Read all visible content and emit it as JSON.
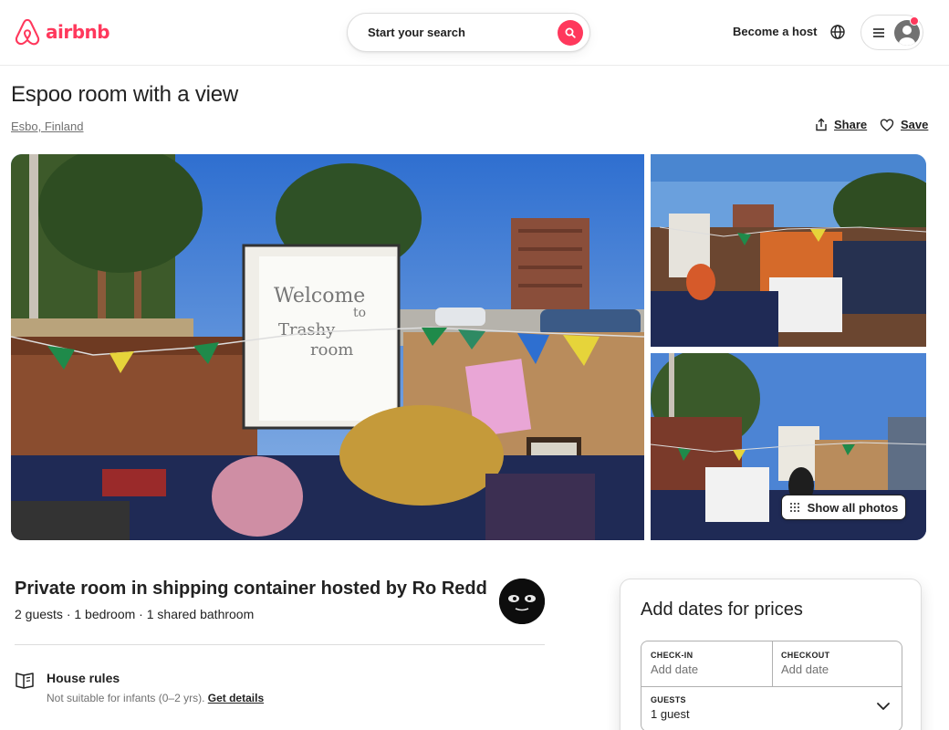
{
  "header": {
    "brand": "airbnb",
    "search_placeholder": "Start your search",
    "host_link": "Become a host"
  },
  "listing": {
    "title": "Espoo room with a view",
    "location": "Esbo, Finland",
    "share_label": "Share",
    "save_label": "Save"
  },
  "gallery": {
    "show_all_label": "Show all photos",
    "main_photo_words": [
      "Welcome",
      "to",
      "Trashy",
      "room"
    ]
  },
  "host_section": {
    "heading": "Private room in shipping container hosted by Ro Redd",
    "details": "2 guests · 1 bedroom · 1 shared bathroom"
  },
  "house_rules": {
    "title": "House rules",
    "text": "Not suitable for infants (0–2 yrs).",
    "link": "Get details"
  },
  "booking": {
    "title": "Add dates for prices",
    "checkin_label": "CHECK-IN",
    "checkin_value": "Add date",
    "checkout_label": "CHECKOUT",
    "checkout_value": "Add date",
    "guests_label": "GUESTS",
    "guests_value": "1 guest"
  },
  "colors": {
    "brand": "#FF385C",
    "text": "#222222",
    "muted": "#717171"
  },
  "icons": [
    "airbnb-logo-icon",
    "search-icon",
    "globe-icon",
    "menu-icon",
    "user-icon",
    "share-icon",
    "heart-icon",
    "grid-icon",
    "house-rules-icon",
    "chevron-down-icon"
  ]
}
